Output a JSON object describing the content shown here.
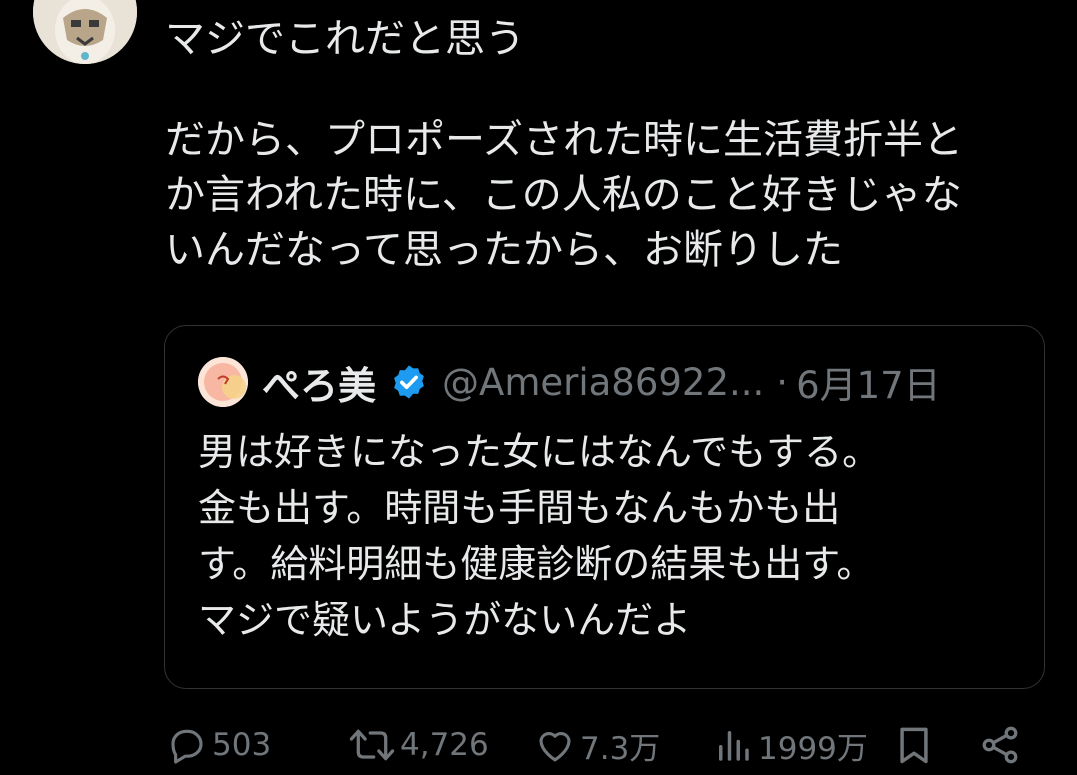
{
  "tweet": {
    "line1": "マジでこれだと思う",
    "para2": [
      "だから、プロポーズされた時に生活費折半と",
      "か言われた時に、この人私のこと好きじゃな",
      "いんだなって思ったから、お断りした"
    ]
  },
  "quote": {
    "name": "ぺろ美",
    "handle": "@Ameria86922...",
    "separator": "·",
    "date": "6月17日",
    "body": [
      "男は好きになった女にはなんでもする。",
      "金も出す。時間も手間もなんもかも出",
      "す。給料明細も健康診断の結果も出す。",
      "マジで疑いようがないんだよ"
    ]
  },
  "actions": {
    "replies": "503",
    "reposts": "4,726",
    "likes": "7.3万",
    "views": "1999万"
  },
  "colors": {
    "background": "#000000",
    "text": "#e7e9ea",
    "muted": "#71767b",
    "border": "#2f3336",
    "verified": "#1d9bf0"
  }
}
